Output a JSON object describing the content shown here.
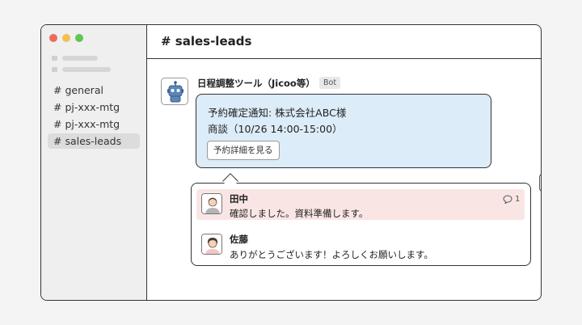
{
  "channels": [
    "# general",
    "# pj-xxx-mtg",
    "# pj-xxx-mtg",
    "# sales-leads"
  ],
  "active_channel_index": 3,
  "header": {
    "title": "# sales-leads"
  },
  "bot_message": {
    "sender": "日程調整ツール（Jicoo等）",
    "badge": "Bot",
    "card_line1": "予約確定通知: 株式会社ABC様",
    "card_line2": "商談（10/26 14:00-15:00）",
    "button_label": "予約詳細を見る"
  },
  "thread": {
    "messages": [
      {
        "name": "田中",
        "text": "確認しました。資料準備します。",
        "reply_count": "1",
        "highlighted": true
      },
      {
        "name": "佐藤",
        "text": "ありがとうございます！よろしくお願いします。",
        "highlighted": false
      }
    ]
  },
  "colors": {
    "traffic_red": "#ed6a5e",
    "traffic_yellow": "#f4bf4f",
    "traffic_green": "#61c554",
    "card_bg": "#dcecf8",
    "highlight_bg": "#fae5e5",
    "bot_blue": "#5b86b8",
    "avatar_pink": "#f3c5c5"
  },
  "icons": {
    "bot": "robot-icon",
    "share": "share-arrow-icon",
    "reply": "speech-bubble-icon",
    "user": "person-icon"
  }
}
